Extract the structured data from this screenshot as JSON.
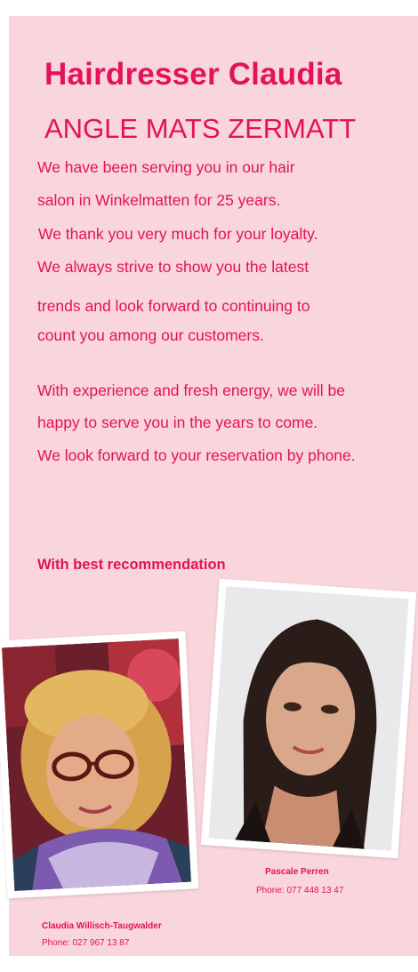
{
  "header": {
    "title": "Hairdresser Claudia",
    "subtitle": "ANGLE MATS ZERMATT"
  },
  "body_text": {
    "lines": [
      "We have been serving you in our hair",
      "salon in Winkelmatten for 25 years.",
      "We thank you very much for your loyalty.",
      "We always strive to show you the latest",
      "trends and look forward to continuing to",
      "count you among our customers.",
      "With experience and fresh energy, we will be",
      "happy to serve you in the years to come.",
      "We look forward to your reservation by phone."
    ]
  },
  "closing": "With best recommendation",
  "staff": [
    {
      "name": "Claudia Willisch-Taugwalder",
      "phone": "Phone: 027 967 13 87"
    },
    {
      "name": "Pascale Perren",
      "phone": "Phone: 077 448 13 47"
    }
  ],
  "colors": {
    "accent": "#e3125b",
    "panel_background": "#f9d5dc",
    "page_background": "#ffffff"
  }
}
